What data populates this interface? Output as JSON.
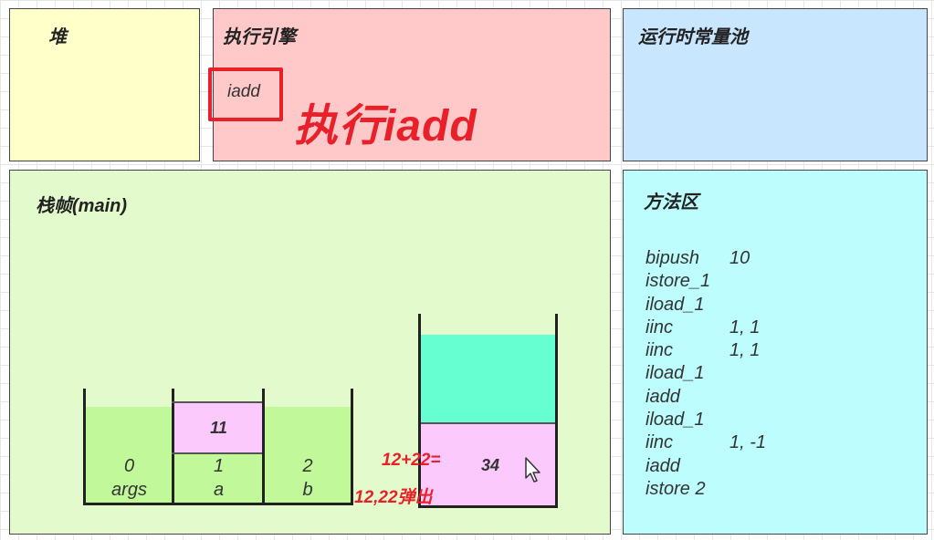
{
  "heap": {
    "title": "堆"
  },
  "engine": {
    "title": "执行引擎",
    "current_instruction": "iadd",
    "annotation": "执行iadd"
  },
  "constant_pool": {
    "title": "运行时常量池"
  },
  "frame": {
    "title": "栈帧(main)",
    "local_vars": [
      {
        "index": "0",
        "name": "args",
        "value": ""
      },
      {
        "index": "1",
        "name": "a",
        "value": "11"
      },
      {
        "index": "2",
        "name": "b",
        "value": ""
      }
    ],
    "operand_stack": {
      "top_value": "34"
    },
    "notes": {
      "sum": "12+22=",
      "popped": "12,22弹出"
    }
  },
  "method_area": {
    "title": "方法区",
    "instructions": [
      {
        "op": "bipush",
        "arg": "10"
      },
      {
        "op": "istore_1",
        "arg": ""
      },
      {
        "op": "iload_1",
        "arg": ""
      },
      {
        "op": "iinc",
        "arg": "1, 1"
      },
      {
        "op": "iinc",
        "arg": "1, 1"
      },
      {
        "op": "iload_1",
        "arg": ""
      },
      {
        "op": "iadd",
        "arg": ""
      },
      {
        "op": "iload_1",
        "arg": ""
      },
      {
        "op": "iinc",
        "arg": "1, -1"
      },
      {
        "op": "iadd",
        "arg": ""
      },
      {
        "op": "istore 2",
        "arg": ""
      }
    ]
  },
  "colors": {
    "heap": "#ffffc9",
    "engine": "#ffc9c9",
    "pool": "#c9e6ff",
    "frame": "#e3fbcc",
    "method": "#bdfdfd",
    "slot_fill": "#c1f99a",
    "value_fill": "#fcc9fc",
    "stack_empty": "#66ffd1",
    "highlight": "#e8202a"
  }
}
